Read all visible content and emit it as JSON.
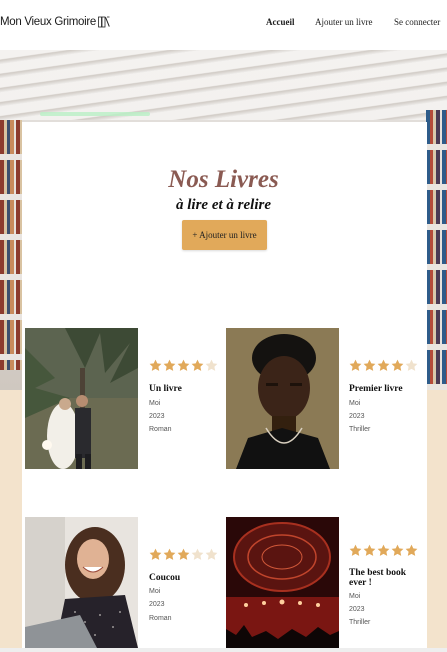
{
  "brand": {
    "name": "Mon Vieux Grimoire",
    "icon": "book-logo-icon"
  },
  "nav": {
    "items": [
      {
        "label": "Accueil",
        "active": true
      },
      {
        "label": "Ajouter un livre",
        "active": false
      },
      {
        "label": "Se connecter",
        "active": false
      }
    ]
  },
  "hero": {
    "title": "Nos Livres",
    "subtitle": "à lire et à relire",
    "add_button": "+ Ajouter un livre"
  },
  "colors": {
    "accent": "#e1a95a",
    "title": "#8a5a52",
    "star_filled": "#e1a95a",
    "star_empty": "#f0e2cd",
    "page_bg": "#f3e3cc"
  },
  "books": [
    {
      "title": "Un livre",
      "author": "Moi",
      "year": "2023",
      "genre": "Roman",
      "rating": 4,
      "cover": "wedding-couple-photo"
    },
    {
      "title": "Premier livre",
      "author": "Moi",
      "year": "2023",
      "genre": "Thriller",
      "rating": 4,
      "cover": "man-portrait-photo"
    },
    {
      "title": "Coucou",
      "author": "Moi",
      "year": "2023",
      "genre": "Roman",
      "rating": 3,
      "cover": "laughing-woman-laptop-photo"
    },
    {
      "title": "The best book ever !",
      "author": "Moi",
      "year": "2023",
      "genre": "Thriller",
      "rating": 5,
      "cover": "concert-stage-photo"
    }
  ]
}
